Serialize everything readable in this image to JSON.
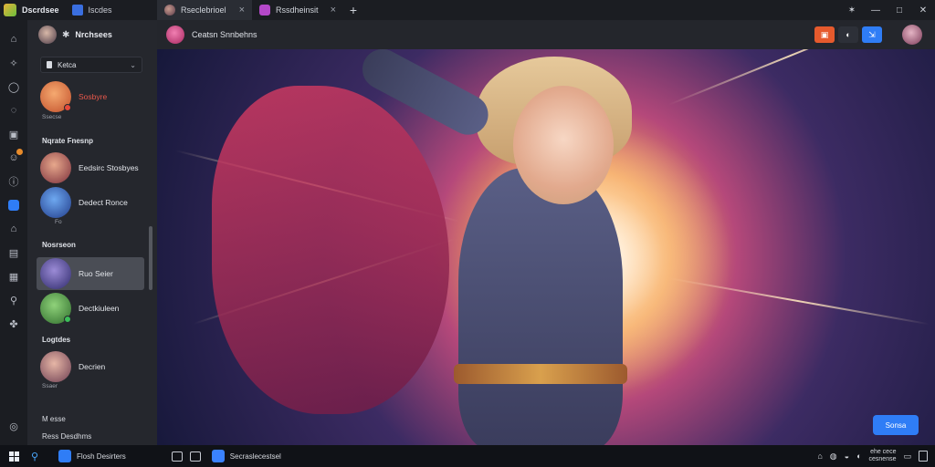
{
  "window": {
    "app_title": "Dscrdsee",
    "app_sub": "Iscdes"
  },
  "tabs": [
    {
      "label": "Rseclebrioel",
      "close": "×"
    },
    {
      "label": "Rssdheinsit",
      "close": "×"
    }
  ],
  "tab_add": "+",
  "win_controls": {
    "pin": "✶",
    "minimize": "—",
    "maximize": "□",
    "close": "✕"
  },
  "rail_icons": [
    "home-icon",
    "star-icon",
    "chat-icon",
    "explore-icon",
    "window-icon",
    "people-icon",
    "info-icon",
    "active-icon",
    "building-icon",
    "doc-icon",
    "list-icon",
    "pin-icon",
    "apps-icon",
    "settings-icon"
  ],
  "panel": {
    "header_name": "Nrchsees",
    "select_value": "Ketca",
    "contacts": [
      {
        "name": "Sosbyre",
        "sub": "Ssecse"
      },
      {
        "name": "Eedsirc Stosbyes"
      },
      {
        "name": "Dedect Ronce",
        "sub": "Fo"
      },
      {
        "name": "Ruo Seier"
      },
      {
        "name": "Dectkiuleen"
      },
      {
        "name": "Decrien",
        "sub": "Ssaer"
      }
    ],
    "sections": [
      "Nqrate Fnesnp",
      "Nosrseon",
      "Logtdes"
    ],
    "footer1": "M esse",
    "footer2": "Ress Desdhms"
  },
  "chat_header": {
    "title": "Ceatsn Snnbehns"
  },
  "fab_label": "Sonsa",
  "taskbar": {
    "search_text": "Flosh Desirters",
    "app_text": "Secraslecestsel",
    "clock_time": "ehe cece",
    "clock_date": "cesnense"
  },
  "colors": {
    "accent": "#2f7df6",
    "notification": "#e88b2a",
    "tool_orange": "#e65a2d",
    "name_red": "#e9584b"
  }
}
